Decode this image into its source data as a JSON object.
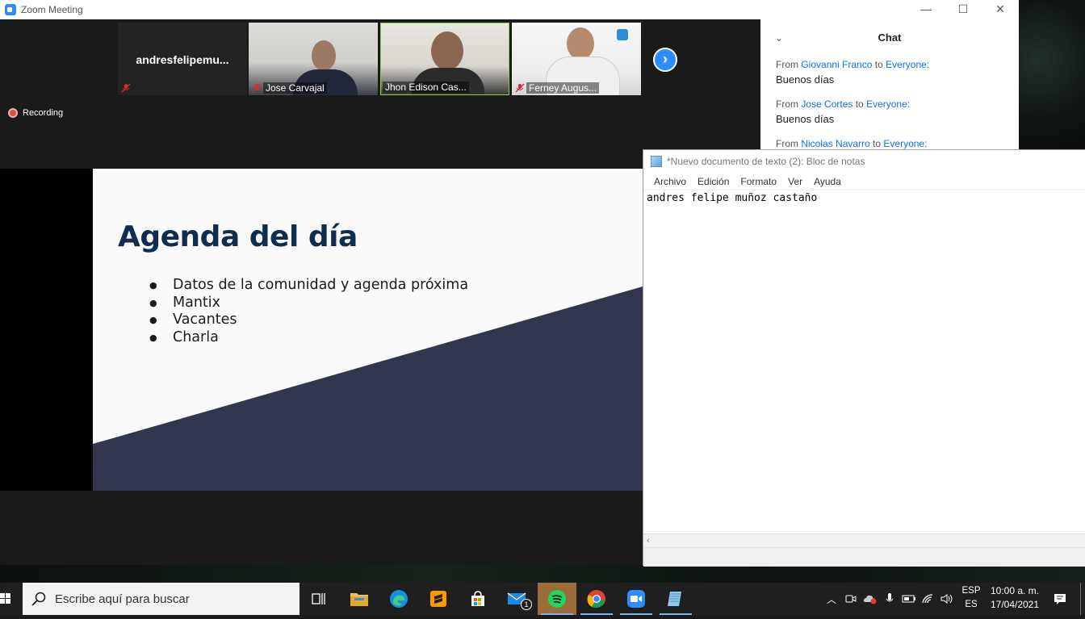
{
  "zoom": {
    "window_title": "Zoom Meeting",
    "participants": [
      {
        "name": "andresfelipemu...",
        "muted": true
      },
      {
        "name": "Jose Carvajal",
        "muted": true
      },
      {
        "name": "Jhon Edison Cas...",
        "muted": false,
        "active_speaker": true
      },
      {
        "name": "Ferney Augus...",
        "muted": true
      }
    ],
    "recording_label": "Recording",
    "chat": {
      "title": "Chat",
      "messages": [
        {
          "from_prefix": "From",
          "from": "Giovanni Franco",
          "to_prefix": "to",
          "to": "Everyone:",
          "text": "Buenos días"
        },
        {
          "from_prefix": "From",
          "from": "Jose Cortes",
          "to_prefix": "to",
          "to": "Everyone:",
          "text": "Buenos días"
        },
        {
          "from_prefix": "From",
          "from": "Nicolas Navarro",
          "to_prefix": "to",
          "to": "Everyone:",
          "text": ""
        }
      ]
    }
  },
  "slide": {
    "title": "Agenda del día",
    "items": [
      "Datos de la comunidad y agenda próxima",
      "Mantix",
      "Vacantes",
      "Charla"
    ]
  },
  "notepad": {
    "title": "*Nuevo documento de texto (2): Bloc de notas",
    "menu": [
      "Archivo",
      "Edición",
      "Formato",
      "Ver",
      "Ayuda"
    ],
    "content": "andres felipe muñoz castaño"
  },
  "taskbar": {
    "search_placeholder": "Escribe aquí para buscar",
    "mail_badge": "1",
    "language_top": "ESP",
    "language_bottom": "ES",
    "time": "10:00 a. m.",
    "date": "17/04/2021"
  },
  "colors": {
    "zoom_blue": "#2d8cff",
    "slide_title": "#0f2d4e",
    "slide_band": "#33364f",
    "taskbar": "#1f1f1f"
  }
}
